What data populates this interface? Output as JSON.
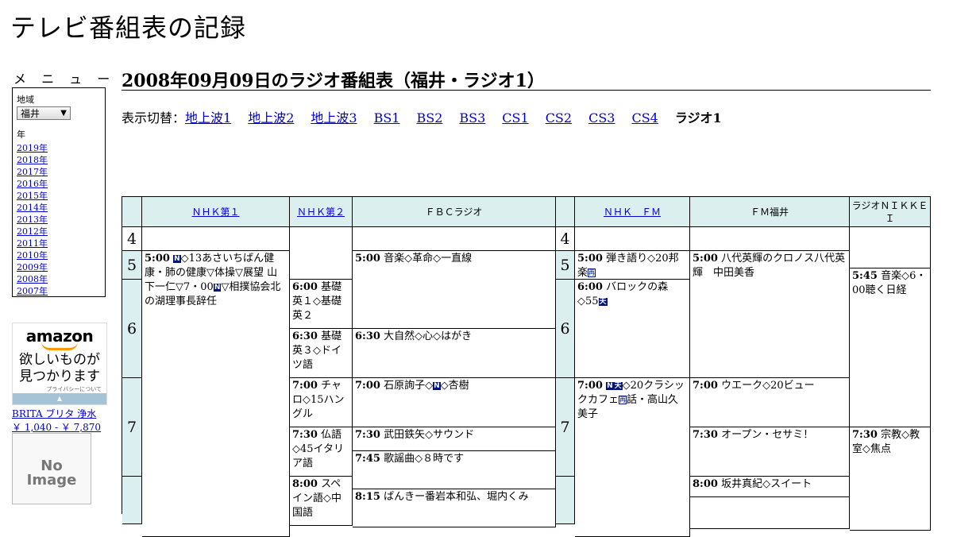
{
  "site": {
    "title": "テレビ番組表の記録"
  },
  "menu": {
    "heading": "メ ニ ュ ー",
    "region_label": "地域",
    "region_value": "福井",
    "year_label": "年",
    "years": [
      "2019年",
      "2018年",
      "2017年",
      "2016年",
      "2015年",
      "2014年",
      "2013年",
      "2012年",
      "2011年",
      "2010年",
      "2009年",
      "2008年",
      "2007年"
    ]
  },
  "ad": {
    "logo": "amazon",
    "text_line1": "欲しいものが",
    "text_line2": "見つかります",
    "privacy": "プライバシーについて",
    "product_name": "BRITA ブリタ 浄水",
    "product_price": "￥ 1,040 - ￥ 7,870",
    "noimage_line1": "No",
    "noimage_line2": "Image"
  },
  "page": {
    "heading": "2008年09月09日のラジオ番組表（福井・ラジオ1）",
    "switch_label": "表示切替：",
    "switch_links": [
      "地上波1",
      "地上波2",
      "地上波3",
      "BS1",
      "BS2",
      "BS3",
      "CS1",
      "CS2",
      "CS3",
      "CS4"
    ],
    "switch_current": "ラジオ1"
  },
  "grid": {
    "channels": [
      "ＮＨＫ第１",
      "ＮＨＫ第２",
      "ＦＢＣラジオ",
      "ＮＨＫ　ＦＭ",
      "ＦＭ福井",
      "ラジオＮＩＫＫＥＩ"
    ],
    "hours": [
      "4",
      "5",
      "6",
      "7",
      "4",
      "5",
      "6",
      "7"
    ],
    "programs": {
      "nhk1_500": {
        "time": "5:00",
        "a": "◇13あさいちばん健康・肺の健康▽体操▽展望 山下一仁▽7・00",
        "b": "▽相撲協会北の湖理事長辞任"
      },
      "nhk2_600": {
        "time": "6:00",
        "text": "基礎英１◇基礎英２"
      },
      "nhk2_630": {
        "time": "6:30",
        "text": "基礎英３◇ドイツ語"
      },
      "nhk2_700": {
        "time": "7:00",
        "text": "チャロ◇15ハングル"
      },
      "nhk2_730": {
        "time": "7:30",
        "text": "仏語◇45イタリア語"
      },
      "nhk2_800": {
        "time": "8:00",
        "text": "スペイン語◇中国語"
      },
      "fbc_500": {
        "time": "5:00",
        "text": "音楽◇革命◇一直線"
      },
      "fbc_630": {
        "time": "6:30",
        "text": "大自然◇心◇はがき"
      },
      "fbc_700": {
        "time": "7:00",
        "a": "石原詢子◇",
        "b": "◇杏樹"
      },
      "fbc_730": {
        "time": "7:30",
        "text": "武田鉄矢◇サウンド"
      },
      "fbc_745": {
        "time": "7:45",
        "text": "歌謡曲◇８時です"
      },
      "fbc_815": {
        "time": "8:15",
        "text": "ばんきー番岩本和弘、堀内くみ"
      },
      "fm_500": {
        "time": "5:00",
        "text": "弾き語り◇20邦楽"
      },
      "fm_600": {
        "time": "6:00",
        "text": "バロックの森◇55"
      },
      "fm_700": {
        "time": "7:00",
        "a": "◇20クラシックカフェ",
        "b": "話・高山久美子"
      },
      "fmf_500": {
        "time": "5:00",
        "text": "八代英輝のクロノス八代英輝　中田美香"
      },
      "fmf_700": {
        "time": "7:00",
        "text": "ウエーク◇20ビュー"
      },
      "fmf_730": {
        "time": "7:30",
        "text": "オープン・セサミ！"
      },
      "fmf_800": {
        "time": "8:00",
        "text": "坂井真紀◇スイート"
      },
      "nik_545": {
        "time": "5:45",
        "text": "音楽◇6・00聴く日経"
      },
      "nik_730": {
        "time": "7:30",
        "text": "宗教◇教室◇焦点"
      }
    },
    "badges": {
      "news": "N",
      "weather": "天",
      "rebroadcast": "再"
    }
  },
  "colors": {
    "header_bg": "#dcefef",
    "link": "#0000cc",
    "badge": "#00147a"
  }
}
